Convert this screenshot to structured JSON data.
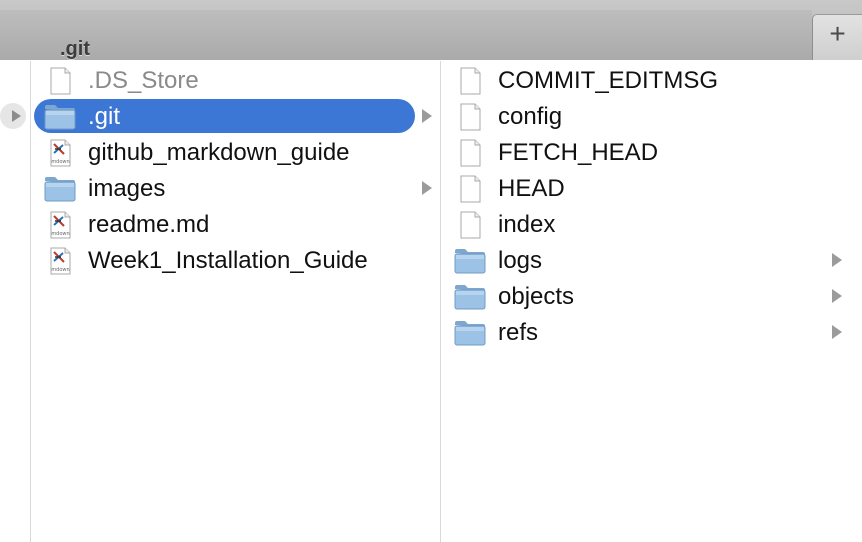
{
  "window": {
    "tab_title": ".git",
    "new_tab_glyph": "+"
  },
  "columns": [
    {
      "items": [
        {
          "label": ".DS_Store",
          "icon": "document-icon",
          "dimmed": true
        },
        {
          "label": ".git",
          "icon": "folder-icon",
          "selected": true,
          "has_children": true
        },
        {
          "label": "github_markdown_guide",
          "icon": "mdown-file-icon",
          "badge": "mdown"
        },
        {
          "label": "images",
          "icon": "folder-icon",
          "has_children": true
        },
        {
          "label": "readme.md",
          "icon": "mdown-file-icon",
          "badge": "mdown"
        },
        {
          "label": "Week1_Installation_Guide",
          "icon": "mdown-file-icon",
          "badge": "mdown"
        }
      ]
    },
    {
      "items": [
        {
          "label": "COMMIT_EDITMSG",
          "icon": "document-icon"
        },
        {
          "label": "config",
          "icon": "document-icon"
        },
        {
          "label": "FETCH_HEAD",
          "icon": "document-icon"
        },
        {
          "label": "HEAD",
          "icon": "document-icon"
        },
        {
          "label": "index",
          "icon": "document-icon"
        },
        {
          "label": "logs",
          "icon": "folder-icon",
          "has_children": true
        },
        {
          "label": "objects",
          "icon": "folder-icon",
          "has_children": true
        },
        {
          "label": "refs",
          "icon": "folder-icon",
          "has_children": true
        }
      ]
    }
  ],
  "colors": {
    "selection": "#3c77d6",
    "folder": "#8fb8de"
  }
}
